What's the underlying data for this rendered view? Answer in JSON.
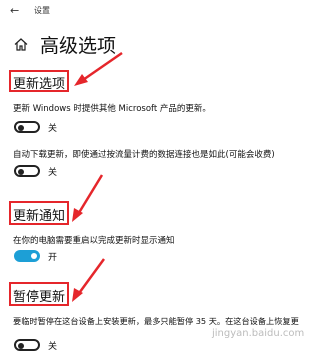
{
  "titlebar": {
    "back_glyph": "←",
    "title": "设置"
  },
  "page": {
    "title": "高级选项"
  },
  "sections": {
    "update_options": {
      "title": "更新选项",
      "item1_desc": "更新 Windows 时提供其他 Microsoft 产品的更新。",
      "item1_state": "关",
      "item2_desc": "自动下载更新，即使通过按流量计费的数据连接也是如此(可能会收费)",
      "item2_state": "关"
    },
    "update_notifications": {
      "title": "更新通知",
      "item1_desc": "在你的电脑需要重启以完成更新时显示通知",
      "item1_state": "开"
    },
    "pause_updates": {
      "title": "暂停更新",
      "item1_desc": "要临时暂停在这台设备上安装更新，最多只能暂停 35 天。在这台设备上恢复更",
      "item1_state": "关"
    }
  },
  "watermark": "jingyan.baidu.com",
  "colors": {
    "accent": "#1d9fd6",
    "annotation": "#e5262b"
  }
}
